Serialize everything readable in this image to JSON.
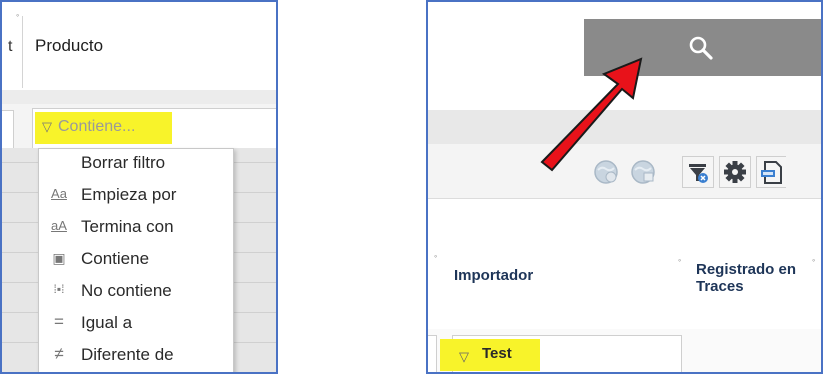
{
  "left_panel": {
    "column_fragment": "t",
    "column_header": "Producto",
    "filter_placeholder": "Contiene...",
    "filter_icon": "funnel-icon",
    "menu_items": [
      {
        "icon": "",
        "label": "Borrar filtro"
      },
      {
        "icon": "Aa",
        "label": "Empieza por"
      },
      {
        "icon": "aA",
        "label": "Termina con"
      },
      {
        "icon": "▣",
        "label": "Contiene"
      },
      {
        "icon": "⁞▪⁞",
        "label": "No contiene"
      },
      {
        "icon": "=",
        "label": "Igual a"
      },
      {
        "icon": "≠",
        "label": "Diferente de"
      }
    ]
  },
  "right_panel": {
    "search_icon": "magnifier-icon",
    "toolbar_icons": [
      "globe-refresh-icon",
      "globe-icon",
      "clear-filter-icon",
      "gear-icon",
      "export-icon"
    ],
    "columns": [
      {
        "label": "Importador"
      },
      {
        "label": "Registrado en Traces"
      }
    ],
    "filter_value": "Test"
  },
  "colors": {
    "highlight": "#f8f32a",
    "arrow": "#e8121a",
    "panel_border": "#4a72c4",
    "search_button": "#8a8a8a"
  }
}
